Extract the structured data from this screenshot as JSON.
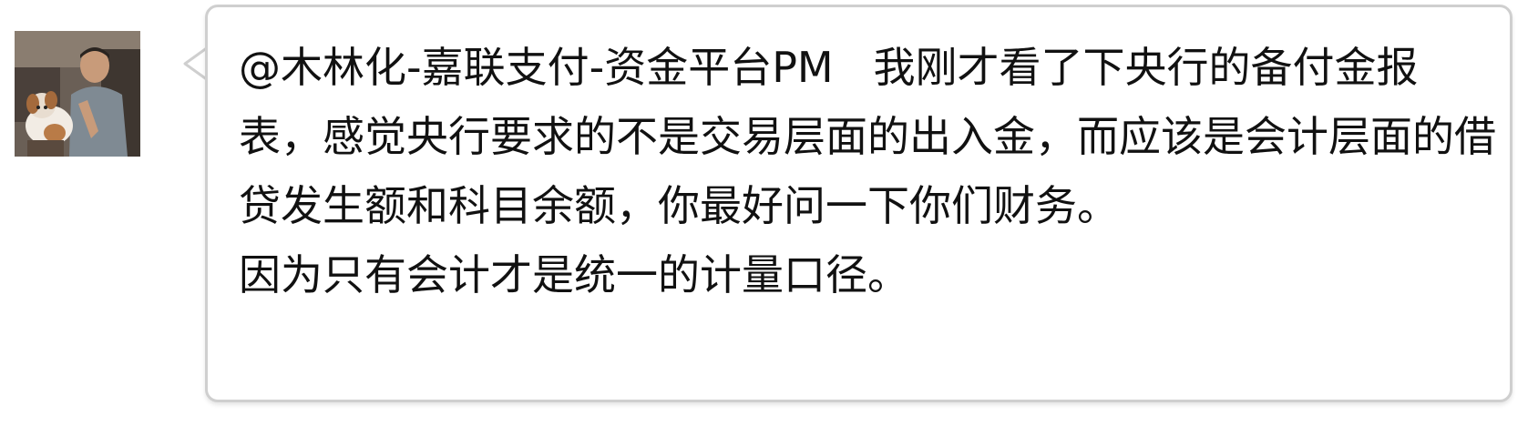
{
  "message": {
    "text": "@木林化-嘉联支付-资金平台PM   我刚才看了下央行的备付金报表，感觉央行要求的不是交易层面的出入金，而应该是会计层面的借贷发生额和科目余额，你最好问一下你们财务。\n因为只有会计才是统一的计量口径。"
  },
  "colors": {
    "bubble_border": "#cfcfcf",
    "bubble_background": "#ffffff",
    "text": "#111111"
  },
  "icons": {
    "avatar": "user-avatar-photo"
  }
}
